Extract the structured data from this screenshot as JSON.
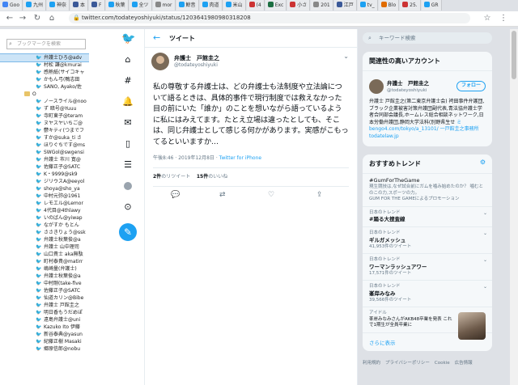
{
  "tabs": [
    {
      "label": "Goo",
      "color": "#4285f4"
    },
    {
      "label": "九州",
      "color": "#1da1f2"
    },
    {
      "label": "神奈",
      "color": "#1da1f2"
    },
    {
      "label": "本",
      "color": "#3b5998"
    },
    {
      "label": "F",
      "color": "#3b5998"
    },
    {
      "label": "秋葉",
      "color": "#1da1f2"
    },
    {
      "label": "全ツ",
      "color": "#1da1f2"
    },
    {
      "label": "mor",
      "color": "#888888"
    },
    {
      "label": "鯨音",
      "color": "#1da1f2"
    },
    {
      "label": "肉道",
      "color": "#1da1f2"
    },
    {
      "label": "米山",
      "color": "#1da1f2"
    },
    {
      "label": "(4",
      "color": "#cc3333"
    },
    {
      "label": "Exc",
      "color": "#1d6f42"
    },
    {
      "label": "小さ",
      "color": "#cc3333"
    },
    {
      "label": "201",
      "color": "#888888"
    },
    {
      "label": "江戸",
      "color": "#3b5998"
    },
    {
      "label": "tv_",
      "color": "#1da1f2"
    },
    {
      "label": "Blo",
      "color": "#e06c00"
    },
    {
      "label": "25.",
      "color": "#cc3333"
    },
    {
      "label": "GR",
      "color": "#1da1f2"
    }
  ],
  "url": "twitter.com/todateyoshiyuki/status/1203641980980318208",
  "sidebar": {
    "search_placeholder": "ブックマークを検索",
    "items": [
      {
        "label": "弁護士ひろ@adv",
        "type": "bird",
        "selected": true
      },
      {
        "label": "村松 謙@kmurai",
        "type": "bird"
      },
      {
        "label": "感熱紙(サイコキャ",
        "type": "bird"
      },
      {
        "label": "かもん弓(鴨志田",
        "type": "bird"
      },
      {
        "label": "SANO, Ayako/佐",
        "type": "bird"
      },
      {
        "label": "O",
        "type": "folder"
      },
      {
        "label": "ノースライル@noo",
        "type": "bird"
      },
      {
        "label": "ず 暗号@Yuuu",
        "type": "bird"
      },
      {
        "label": "寺町東子@teram",
        "type": "bird"
      },
      {
        "label": "ヌヤスヤいちご@",
        "type": "bird"
      },
      {
        "label": "鬱キティ(つまでフ",
        "type": "bird"
      },
      {
        "label": "すか@suka_ti さ",
        "type": "bird"
      },
      {
        "label": "ほりぐちです@ms",
        "type": "bird"
      },
      {
        "label": "SWGol@swgensi",
        "type": "bird"
      },
      {
        "label": "弁護士 市川 寛@",
        "type": "bird"
      },
      {
        "label": "佐藤正子@SATC",
        "type": "bird"
      },
      {
        "label": "K・9999@sk9",
        "type": "bird"
      },
      {
        "label": "ジリウスA@eeyol",
        "type": "bird"
      },
      {
        "label": "shoya@sho_ya",
        "type": "bird"
      },
      {
        "label": "中村元弥@1961",
        "type": "bird"
      },
      {
        "label": "レモエル@Lemor",
        "type": "bird"
      },
      {
        "label": "4代目@4thlawy",
        "type": "bird"
      },
      {
        "label": "いのばん@yiwap",
        "type": "bird"
      },
      {
        "label": "ながすか もとん",
        "type": "bird"
      },
      {
        "label": "ささきりょう@ssk",
        "type": "bird"
      },
      {
        "label": "弁護士秋葉俊@a",
        "type": "bird"
      },
      {
        "label": "弁護士 山中理司",
        "type": "bird"
      },
      {
        "label": "山口貴士 aka無駄",
        "type": "bird"
      },
      {
        "label": "町村泰貴@matirr",
        "type": "bird"
      },
      {
        "label": "嶋崎量(弁護士)",
        "type": "bird"
      },
      {
        "label": "弁護士秋葉俊@a",
        "type": "bird"
      },
      {
        "label": "中村剛(take-five",
        "type": "bird"
      },
      {
        "label": "佐藤正子@SATC",
        "type": "bird"
      },
      {
        "label": "仙道カリン@Bibe",
        "type": "bird"
      },
      {
        "label": "弁護士 戸館圭之",
        "type": "bird"
      },
      {
        "label": "明日香もうだめぽ",
        "type": "bird"
      },
      {
        "label": "遠島弁護士@uni",
        "type": "bird"
      },
      {
        "label": "Kazuko Ito 伊藤",
        "type": "bird"
      },
      {
        "label": "新谷泰典@yasun",
        "type": "bird"
      },
      {
        "label": "紀藤正樹 Masaki",
        "type": "bird"
      },
      {
        "label": "郷原信郎@nobu",
        "type": "bird"
      }
    ]
  },
  "main": {
    "title": "ツイート",
    "author_name": "弁護士　戸館圭之",
    "author_handle": "@todateyoshiyuki",
    "text": "私の尊敬する弁護士は、どの弁護士も法制度や立法論について語るときは、具体的事件で現行制度では救えなかった目の前にいた「誰か」のことを想いながら語っているように私にはみえてます。たとえ立場は違ったとしても、そこは、同じ弁護士として感じる何かがあります。実感がこもってるといいますか…",
    "timestamp": "午後8:46 · 2019年12月8日 ·",
    "client": "Twitter for iPhone",
    "retweets_count": "2件",
    "retweets_label": "のリツイート",
    "likes_count": "15件",
    "likes_label": "のいいね"
  },
  "right": {
    "search_placeholder": "キーワード検索",
    "related_title": "関連性の高いアカウント",
    "acct_name": "弁護士　戸館圭之",
    "acct_handle": "@todateyoshiyuki",
    "follow_label": "フォロー",
    "acct_bio": "弁護士 戸館圭之(第二東京弁護士会) 袴田事件弁護団,ブラック企業被害対策弁護団副代表,青法協弁護士学者合同部会議長,ホームレス総合相談ネットワーク,日本労働弁護団,静岡大学法科(別野県生せ",
    "acct_bio_link": "ミbengo4.com/tokyo/a_13101/ 一戸館圭之事務所todatelaw.jp",
    "trends_title": "おすすめトレンド",
    "trends": [
      {
        "context": "",
        "name": "#GumForTheGame",
        "tag": true,
        "desc": "現生競技は,なぜ試合前にガムを噛み始めたのか？ 噛むとのこの力,スポーツの力。",
        "promo": "GUM FOR THE GAMEによるプロモーション",
        "count": ""
      },
      {
        "context": "日本のトレンド",
        "name": "#踊る大捜査線",
        "tag": false,
        "desc": "",
        "promo": "",
        "count": ""
      },
      {
        "context": "日本のトレンド",
        "name": "ギルガメッシュ",
        "tag": false,
        "desc": "",
        "promo": "",
        "count": "41,953件のツイート"
      },
      {
        "context": "日本のトレンド",
        "name": "ワーマンラッシュアワー",
        "tag": false,
        "desc": "",
        "promo": "",
        "count": "17,571件のツイート"
      },
      {
        "context": "日本のトレンド",
        "name": "峯岸みなみ",
        "tag": false,
        "desc": "",
        "promo": "",
        "count": "39,566件のツイート"
      }
    ],
    "image_trend": {
      "context": "アイドル",
      "desc": "峯岸みなみさんがAKB48卒業を発表 これで1期生が全員卒業に"
    },
    "show_more": "さらに表示",
    "footer": [
      "利用規約",
      "プライバシーポリシー",
      "Cookie",
      "広告情報"
    ]
  }
}
